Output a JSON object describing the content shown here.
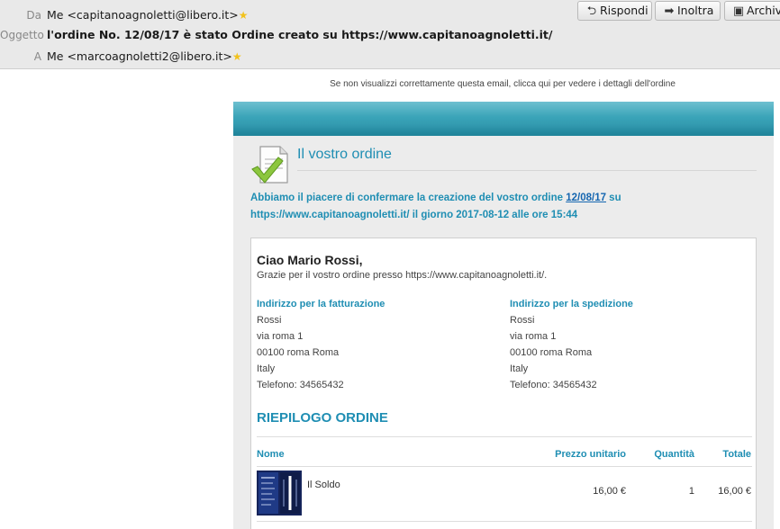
{
  "header": {
    "from_label": "Da",
    "from_value": "Me <capitanoagnoletti@libero.it>",
    "subject_label": "Oggetto",
    "subject_value": "l'ordine No. 12/08/17 è stato Ordine creato su https://www.capitanoagnoletti.it/",
    "to_label": "A",
    "to_value": "Me <marcoagnoletti2@libero.it>",
    "star_icon": "star-icon",
    "buttons": {
      "reply": "Rispondi",
      "forward": "Inoltra",
      "archive": "Archivia"
    }
  },
  "notice": "Se non visualizzi correttamente questa email, clicca qui per vedere i dettagli dell'ordine",
  "email": {
    "title": "Il vostro ordine",
    "confirm_pre": "Abbiamo il piacere di confermare la creazione del vostro ordine ",
    "confirm_link": "12/08/17",
    "confirm_post": " su https://www.capitanoagnoletti.it/ il giorno 2017-08-12 alle ore 15:44",
    "greeting": "Ciao Mario Rossi,",
    "thanks": "Grazie per il vostro ordine presso https://www.capitanoagnoletti.it/.",
    "billing": {
      "heading": "Indirizzo per la fatturazione",
      "name": "Rossi",
      "street": "via roma 1",
      "city": "00100 roma Roma",
      "country": "Italy",
      "phone": "Telefono: 34565432"
    },
    "shipping": {
      "heading": "Indirizzo per la spedizione",
      "name": "Rossi",
      "street": "via roma 1",
      "city": "00100 roma Roma",
      "country": "Italy",
      "phone": "Telefono: 34565432"
    },
    "summary_title": "RIEPILOGO ORDINE",
    "table": {
      "headers": [
        "Nome",
        "Prezzo unitario",
        "Quantità",
        "Totale"
      ],
      "rows": [
        {
          "name": "Il Soldo",
          "price": "16,00 €",
          "qty": "1",
          "total": "16,00 €"
        }
      ]
    }
  },
  "colors": {
    "accent": "#1f8eb3",
    "banner": "#3aa4b8",
    "header_bg": "#e9e9e9"
  }
}
